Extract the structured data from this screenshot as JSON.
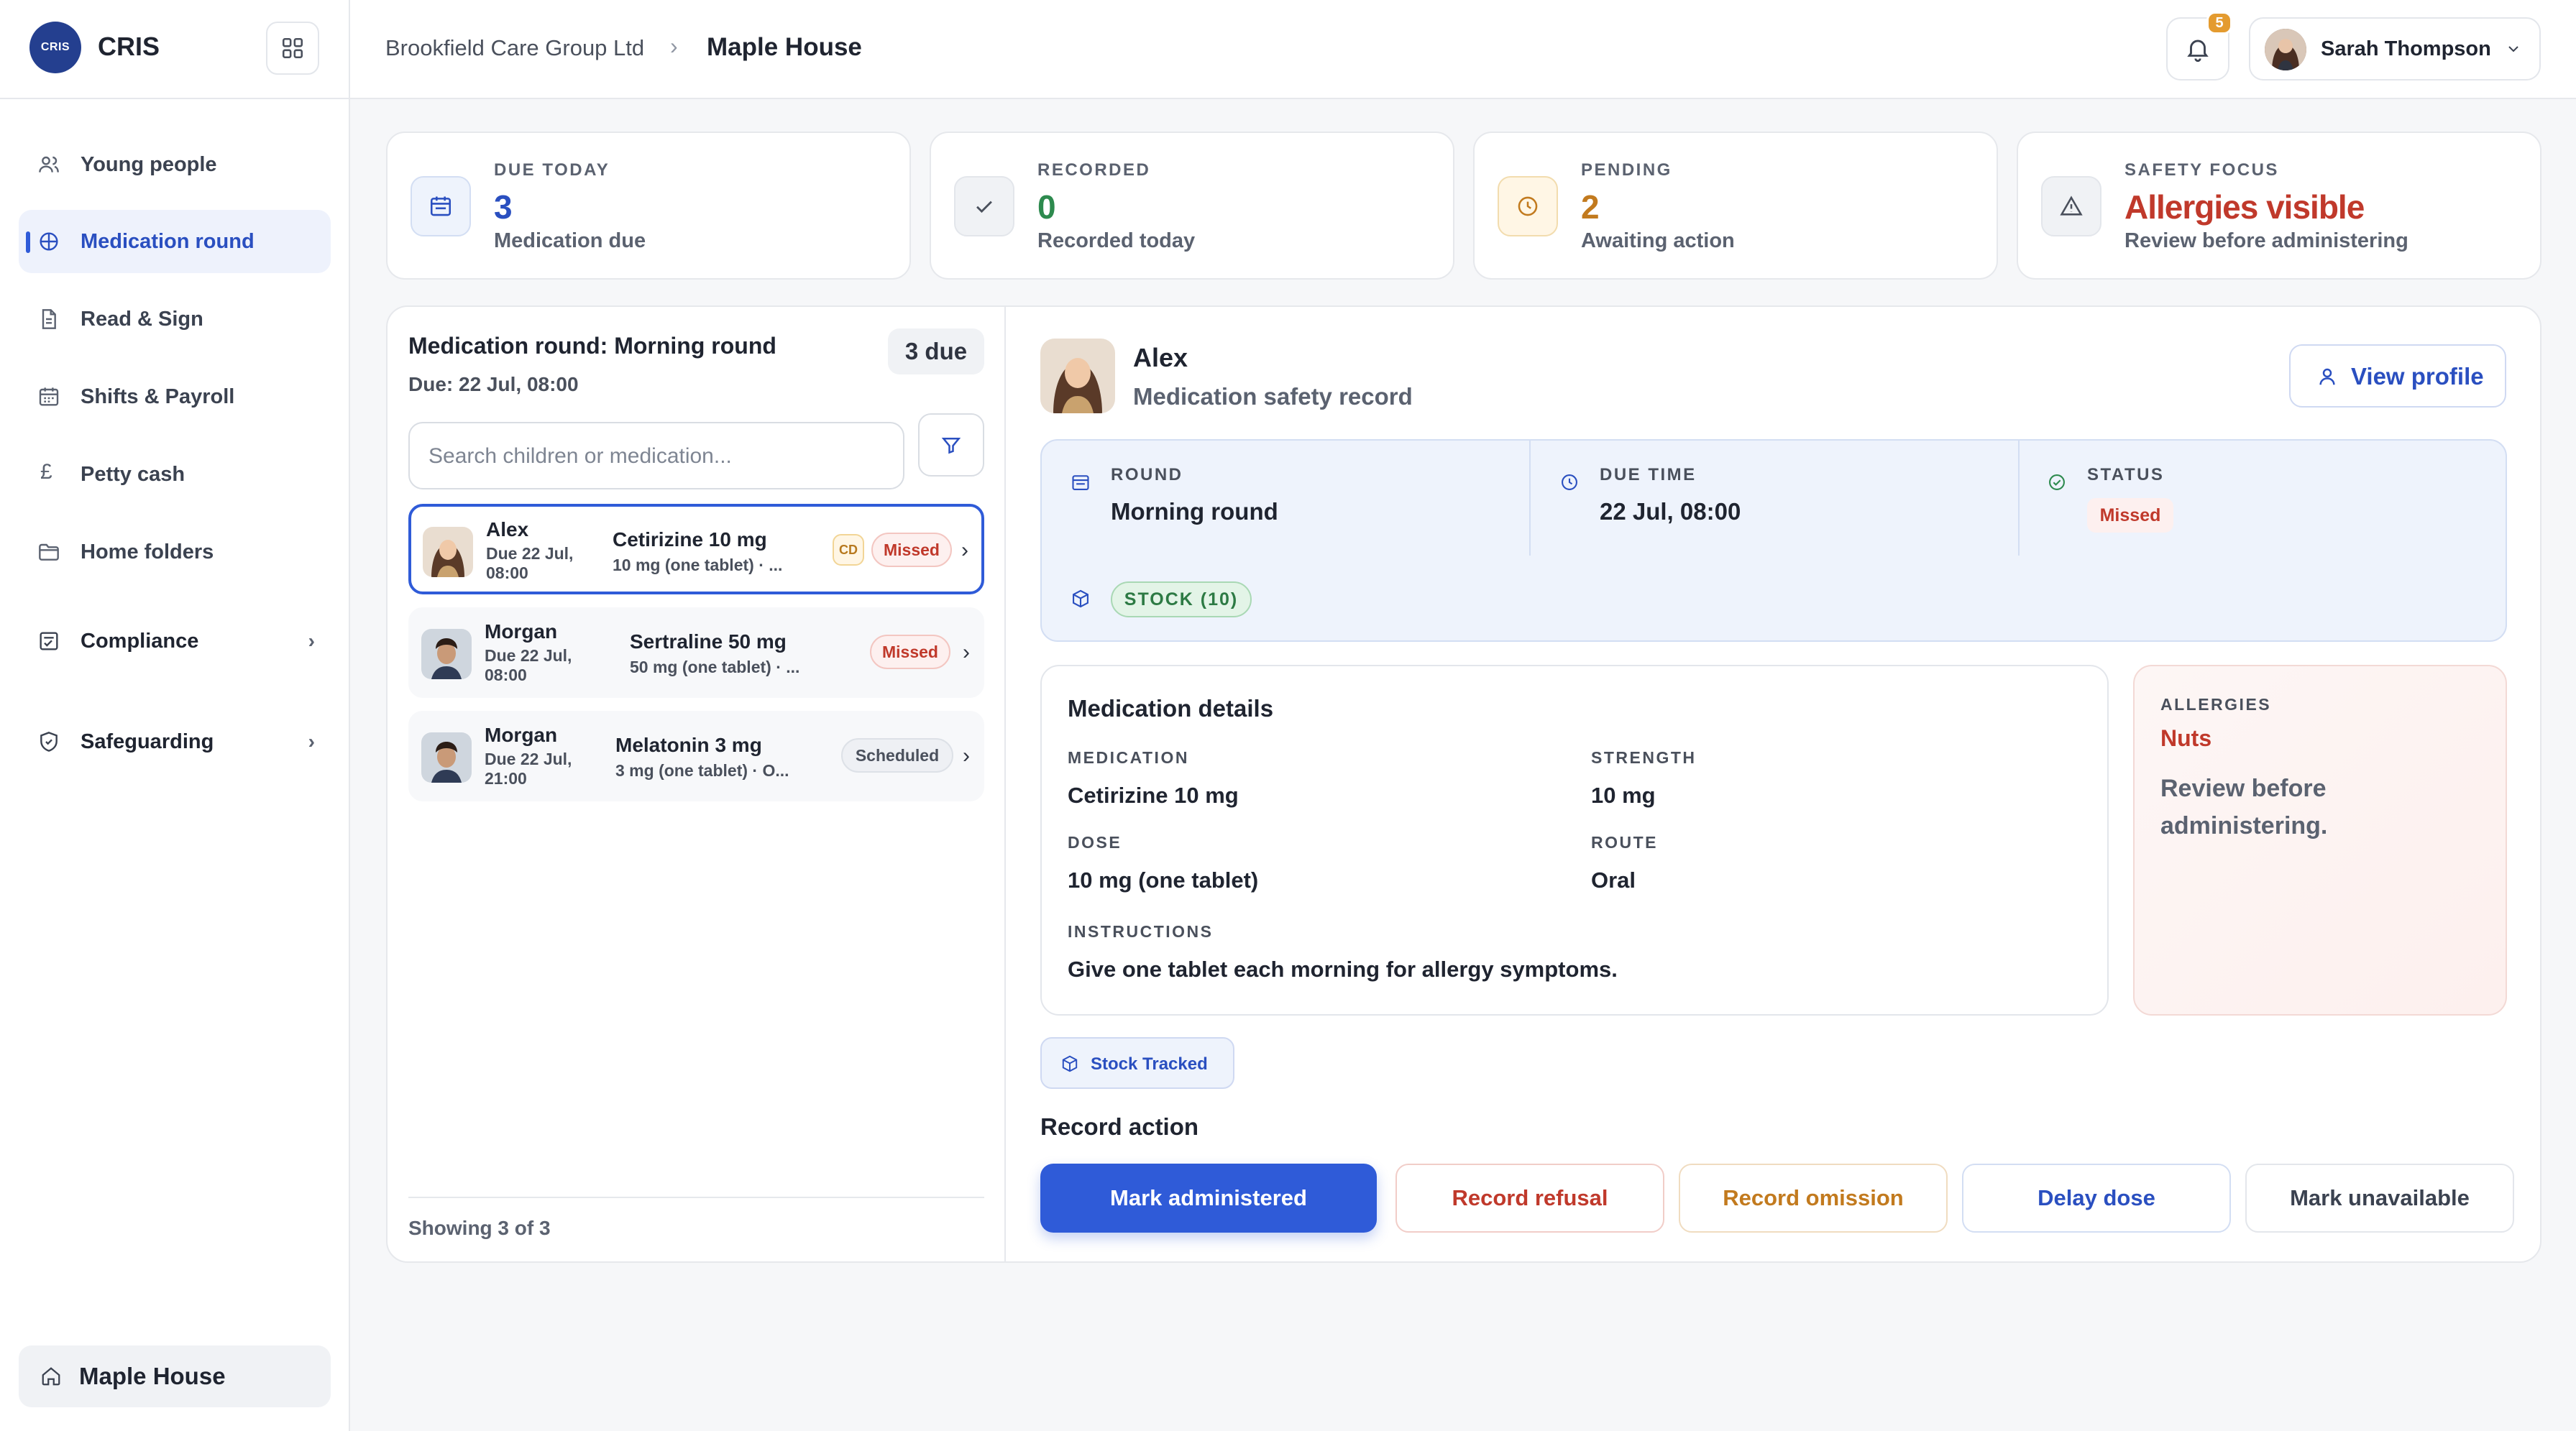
{
  "brand": {
    "logo_text": "CRIS",
    "name": "CRIS"
  },
  "sidebar": {
    "items": [
      {
        "label": "Young people",
        "icon": "users-icon"
      },
      {
        "label": "Medication round",
        "icon": "pill-icon",
        "active": true
      },
      {
        "label": "Read & Sign",
        "icon": "document-icon"
      },
      {
        "label": "Shifts & Payroll",
        "icon": "calendar-icon"
      },
      {
        "label": "Petty cash",
        "icon": "pound-icon",
        "icon_glyph": "£"
      },
      {
        "label": "Home folders",
        "icon": "folder-icon"
      },
      {
        "label": "Compliance",
        "icon": "checklist-icon",
        "expandable": true
      },
      {
        "label": "Safeguarding",
        "icon": "shield-icon",
        "expandable": true
      }
    ],
    "home_switch": "Maple House"
  },
  "header": {
    "breadcrumb_org": "Brookfield Care Group Ltd",
    "breadcrumb_home": "Maple House",
    "notification_count": "5",
    "user_name": "Sarah Thompson"
  },
  "stats": [
    {
      "label": "DUE TODAY",
      "value": "3",
      "sub": "Medication due",
      "color": "#2a4fc0",
      "icon": "calendar-icon"
    },
    {
      "label": "RECORDED",
      "value": "0",
      "sub": "Recorded today",
      "color": "#2d8a4e",
      "icon": "check-icon"
    },
    {
      "label": "PENDING",
      "value": "2",
      "sub": "Awaiting action",
      "color": "#c27a1e",
      "icon": "clock-icon"
    },
    {
      "label": "SAFETY FOCUS",
      "value": "Allergies visible",
      "sub": "Review before administering",
      "color": "#c0392b",
      "icon": "warning-icon"
    }
  ],
  "round": {
    "title": "Medication round: Morning round",
    "due": "Due: 22 Jul, 08:00",
    "count_badge": "3 due",
    "search_placeholder": "Search children or medication...",
    "rows": [
      {
        "name": "Alex",
        "due": "Due 22 Jul, 08:00",
        "medication": "Cetirizine 10 mg",
        "dose": "10 mg (one tablet) · ...",
        "cd": "CD",
        "status": "Missed",
        "status_type": "missed",
        "selected": true
      },
      {
        "name": "Morgan",
        "due": "Due 22 Jul, 08:00",
        "medication": "Sertraline 50 mg",
        "dose": "50 mg (one tablet) · ...",
        "status": "Missed",
        "status_type": "missed"
      },
      {
        "name": "Morgan",
        "due": "Due 22 Jul, 21:00",
        "medication": "Melatonin 3 mg",
        "dose": "3 mg (one tablet) · O...",
        "status": "Scheduled",
        "status_type": "sched"
      }
    ],
    "footer": "Showing 3 of 3"
  },
  "detail": {
    "name": "Alex",
    "subtitle": "Medication safety record",
    "view_profile": "View profile",
    "round_label": "ROUND",
    "round_value": "Morning round",
    "due_label": "DUE TIME",
    "due_value": "22 Jul, 08:00",
    "status_label": "STATUS",
    "status_value": "Missed",
    "stock_pill": "STOCK (10)",
    "details_title": "Medication details",
    "medication_label": "MEDICATION",
    "medication_value": "Cetirizine 10 mg",
    "strength_label": "STRENGTH",
    "strength_value": "10 mg",
    "dose_label": "DOSE",
    "dose_value": "10 mg (one tablet)",
    "route_label": "ROUTE",
    "route_value": "Oral",
    "instructions_label": "INSTRUCTIONS",
    "instructions_value": "Give one tablet each morning for allergy symptoms.",
    "allergies_label": "ALLERGIES",
    "allergies_value": "Nuts",
    "allergies_note": "Review before administering.",
    "stock_tag": "Stock Tracked",
    "record_action_title": "Record action",
    "actions": {
      "administer": "Mark administered",
      "refusal": "Record refusal",
      "omission": "Record omission",
      "delay": "Delay dose",
      "unavailable": "Mark unavailable"
    }
  },
  "colors": {
    "accent": "#2f5bd8",
    "danger": "#c0392b",
    "success": "#2d8a4e",
    "warning": "#c27a1e"
  }
}
